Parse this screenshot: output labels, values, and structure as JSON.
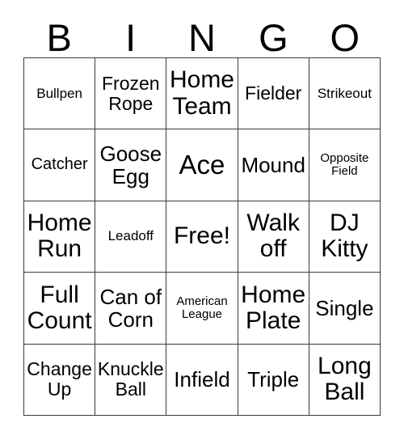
{
  "card": {
    "header_letters": [
      "B",
      "I",
      "N",
      "G",
      "O"
    ],
    "border_color": "#3a3a3a",
    "background_color": "#ffffff",
    "text_color": "#000000",
    "rows": [
      [
        {
          "label": "Bullpen",
          "size": "sm"
        },
        {
          "label": "Frozen\nRope",
          "size": "lg"
        },
        {
          "label": "Home\nTeam",
          "size": "xxl"
        },
        {
          "label": "Fielder",
          "size": "lg"
        },
        {
          "label": "Strikeout",
          "size": "sm"
        }
      ],
      [
        {
          "label": "Catcher",
          "size": "md"
        },
        {
          "label": "Goose\nEgg",
          "size": "xl"
        },
        {
          "label": "Ace",
          "size": "huge"
        },
        {
          "label": "Mound",
          "size": "xl"
        },
        {
          "label": "Opposite\nField",
          "size": "xs"
        }
      ],
      [
        {
          "label": "Home\nRun",
          "size": "xxl"
        },
        {
          "label": "Leadoff",
          "size": "sm"
        },
        {
          "label": "Free!",
          "size": "xxl"
        },
        {
          "label": "Walk\noff",
          "size": "xxl"
        },
        {
          "label": "DJ\nKitty",
          "size": "xxl"
        }
      ],
      [
        {
          "label": "Full\nCount",
          "size": "xxl"
        },
        {
          "label": "Can of\nCorn",
          "size": "xl"
        },
        {
          "label": "American\nLeague",
          "size": "xs"
        },
        {
          "label": "Home\nPlate",
          "size": "xxl"
        },
        {
          "label": "Single",
          "size": "xl"
        }
      ],
      [
        {
          "label": "Change\nUp",
          "size": "lg"
        },
        {
          "label": "Knuckle\nBall",
          "size": "lg"
        },
        {
          "label": "Infield",
          "size": "xl"
        },
        {
          "label": "Triple",
          "size": "xl"
        },
        {
          "label": "Long\nBall",
          "size": "xxl"
        }
      ]
    ]
  }
}
